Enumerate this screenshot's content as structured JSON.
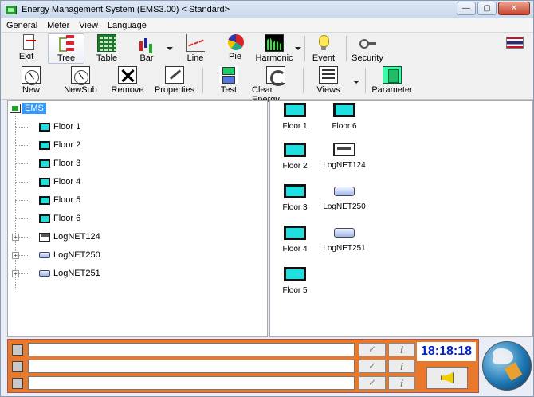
{
  "window": {
    "title": "Energy Management System (EMS3.00) < Standard>",
    "controls": {
      "minimize": "—",
      "maximize": "▢",
      "close": "✕"
    }
  },
  "menu": [
    "General",
    "Meter",
    "View",
    "Language"
  ],
  "toolbar1": {
    "exit": "Exit",
    "tree": "Tree",
    "table": "Table",
    "bar": "Bar",
    "line": "Line",
    "pie": "Pie",
    "harmonic": "Harmonic",
    "event": "Event",
    "security": "Security"
  },
  "toolbar2": {
    "new": "New",
    "newsub": "NewSub",
    "remove": "Remove",
    "properties": "Properties",
    "test": "Test",
    "clear_energy": "Clear Energy",
    "views": "Views",
    "parameter": "Parameter"
  },
  "tree": {
    "root": "EMS",
    "nodes": [
      {
        "label": "Floor 1",
        "type": "floor"
      },
      {
        "label": "Floor 2",
        "type": "floor"
      },
      {
        "label": "Floor 3",
        "type": "floor"
      },
      {
        "label": "Floor 4",
        "type": "floor"
      },
      {
        "label": "Floor 5",
        "type": "floor"
      },
      {
        "label": "Floor 6",
        "type": "floor"
      },
      {
        "label": "LogNET124",
        "type": "lognet124",
        "expandable": true
      },
      {
        "label": "LogNET250",
        "type": "lognet250",
        "expandable": true
      },
      {
        "label": "LogNET251",
        "type": "lognet250",
        "expandable": true
      }
    ]
  },
  "icons": [
    {
      "label": "Floor 1",
      "type": "floor"
    },
    {
      "label": "Floor 6",
      "type": "floor"
    },
    {
      "label": "Floor 2",
      "type": "floor"
    },
    {
      "label": "LogNET124",
      "type": "lognet124"
    },
    {
      "label": "Floor 3",
      "type": "floor"
    },
    {
      "label": "LogNET250",
      "type": "lognet250"
    },
    {
      "label": "Floor 4",
      "type": "floor"
    },
    {
      "label": "LogNET251",
      "type": "lognet250"
    },
    {
      "label": "Floor 5",
      "type": "floor"
    }
  ],
  "status": {
    "ok_glyph": "✓",
    "info_glyph": "i",
    "clock": "18:18:18"
  },
  "colors": {
    "status_bg": "#e8782c",
    "clock_text": "#0020c8",
    "floor_icon": "#1ee0e0",
    "selection": "#3399ff"
  }
}
